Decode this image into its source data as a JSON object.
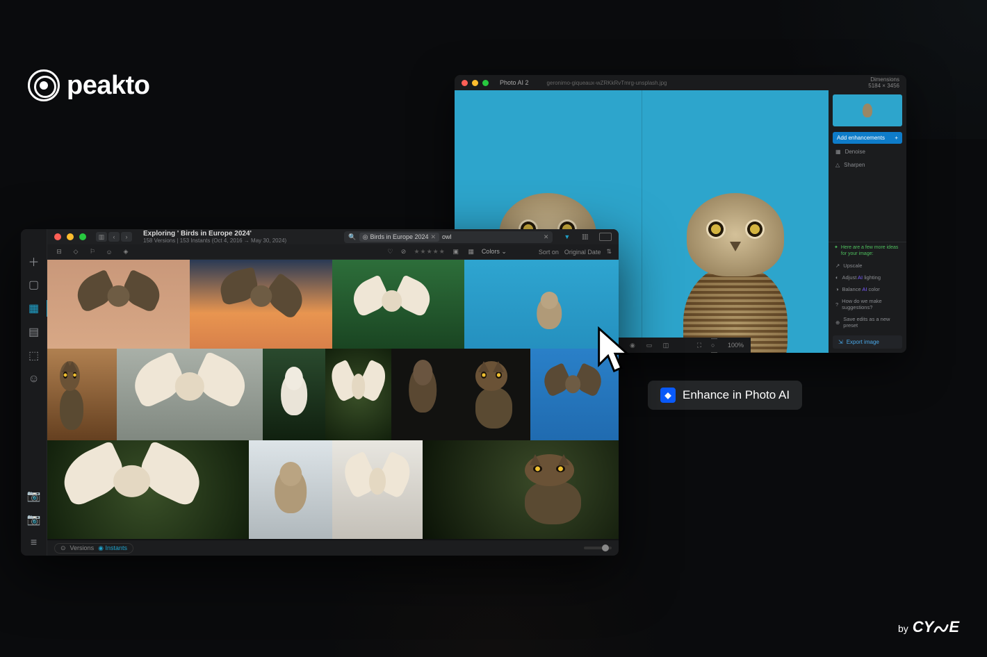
{
  "brand": {
    "name": "peakto"
  },
  "cyme": {
    "by": "by",
    "name": "CYME"
  },
  "enhance": {
    "label": "Enhance in Photo AI",
    "icon": "photo-ai-icon"
  },
  "photoai": {
    "app_title": "Photo AI  2",
    "filename": "geronimo-giqueaux-wZRKkRvTmrg-unsplash.jpg",
    "dimensions_label": "Dimensions",
    "dimensions_value": "5184 × 3456",
    "add_enhancements": "Add enhancements",
    "enhancements": [
      {
        "icon": "denoise-icon",
        "label": "Denoise"
      },
      {
        "icon": "sharpen-icon",
        "label": "Sharpen"
      }
    ],
    "ideas_header": "Here are a few more ideas for your image:",
    "suggestions": [
      {
        "icon": "upscale-icon",
        "label": "Upscale"
      },
      {
        "icon": "adjust-icon",
        "label_pre": "Adjust ",
        "label_ai": "AI",
        "label_post": " lighting"
      },
      {
        "icon": "balance-icon",
        "label_pre": "Balance ",
        "label_ai": "AI",
        "label_post": " color"
      },
      {
        "icon": "help-icon",
        "label": "How do we make suggestions?"
      },
      {
        "icon": "save-icon",
        "label": "Save edits as a new preset"
      }
    ],
    "export_label": "Export image",
    "zoom_label": "100%"
  },
  "peakto": {
    "title": "Exploring ' Birds in Europe 2024'",
    "subtitle": "158 Versions | 153 Instants (Oct 4, 2016 → May 30, 2024)",
    "search_chip": "Birds in Europe 2024",
    "search_term": "owl",
    "sort_label": "Sort on",
    "sort_value": "Original Date",
    "colors_label": "Colors",
    "versions_tab": "Versions",
    "instants_tab": "Instants",
    "sidebar_icons": [
      "plus-icon",
      "square-icon",
      "grid-icon",
      "stack-icon",
      "map-pin-icon",
      "person-icon"
    ],
    "sidebar_bottom_icons": [
      "camera-link-icon",
      "camera-sync-icon"
    ]
  }
}
